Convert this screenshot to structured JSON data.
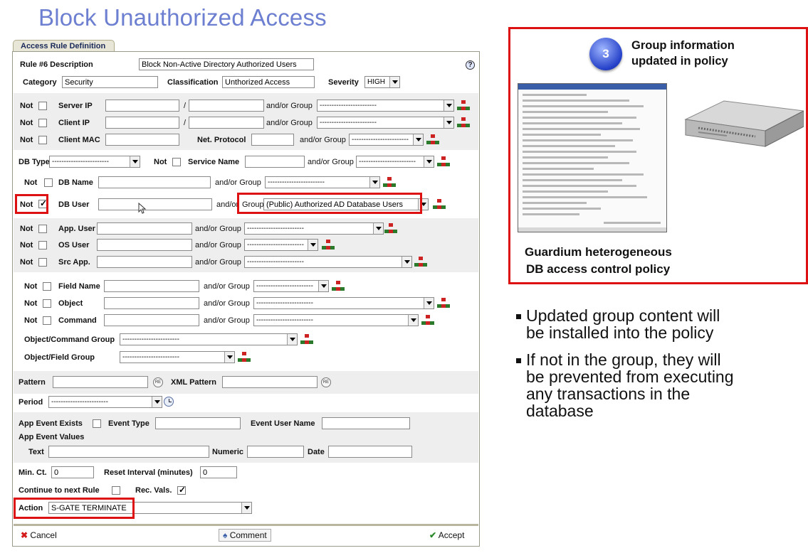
{
  "slide_title": "Block Unauthorized Access",
  "tab_label": "Access Rule Definition",
  "rule": {
    "description_label": "Rule #6 Description",
    "description_value": "Block Non-Active Directory Authorized Users",
    "help_icon": "?",
    "category_label": "Category",
    "category_value": "Security",
    "classification_label": "Classification",
    "classification_value": "Unthorized Access",
    "severity_label": "Severity",
    "severity_value": "HIGH"
  },
  "labels": {
    "not": "Not",
    "and_or_group": "and/or Group",
    "and_or": "and/or",
    "group": "Group",
    "slash": "/",
    "server_ip": "Server IP",
    "client_ip": "Client IP",
    "client_mac": "Client MAC",
    "net_protocol": "Net. Protocol",
    "db_type": "DB Type",
    "service_name": "Service Name",
    "db_name": "DB Name",
    "db_user": "DB User",
    "app_user": "App. User",
    "os_user": "OS User",
    "src_app": "Src App.",
    "field_name": "Field Name",
    "object": "Object",
    "command": "Command",
    "object_command_group": "Object/Command Group",
    "object_field_group": "Object/Field Group",
    "pattern": "Pattern",
    "re": "RE",
    "xml_pattern": "XML Pattern",
    "period": "Period",
    "app_event_exists": "App Event Exists",
    "event_type": "Event Type",
    "event_user_name": "Event User Name",
    "app_event_values": "App Event Values",
    "text": "Text",
    "numeric": "Numeric",
    "date": "Date",
    "min_ct": "Min. Ct.",
    "reset_interval": "Reset Interval (minutes)",
    "continue_next_rule": "Continue to next Rule",
    "rec_vals": "Rec. Vals.",
    "action": "Action"
  },
  "values": {
    "dashes": "------------------------",
    "db_user_group": "(Public) Authorized AD Database Users",
    "min_ct": "0",
    "reset_interval": "0",
    "action": "S-GATE TERMINATE"
  },
  "checks": {
    "db_user_not": true,
    "rec_vals": true
  },
  "buttons": {
    "cancel": "Cancel",
    "comment": "Comment",
    "accept": "Accept"
  },
  "panel": {
    "step_number": "3",
    "title_line1": "Group information",
    "title_line2": "updated in policy",
    "caption_line1": "Guardium heterogeneous",
    "caption_line2": "DB access control policy"
  },
  "bullets": [
    {
      "line1": "Updated group content will",
      "line2": "be installed into the policy"
    },
    {
      "line1": "If not in the group, they will",
      "line2": "be prevented from executing",
      "line3": "any transactions in the",
      "line4": "database"
    }
  ],
  "colors": {
    "title": "#6d7fd0",
    "highlight": "#dd1111",
    "shaded_row": "#eeeeee"
  }
}
